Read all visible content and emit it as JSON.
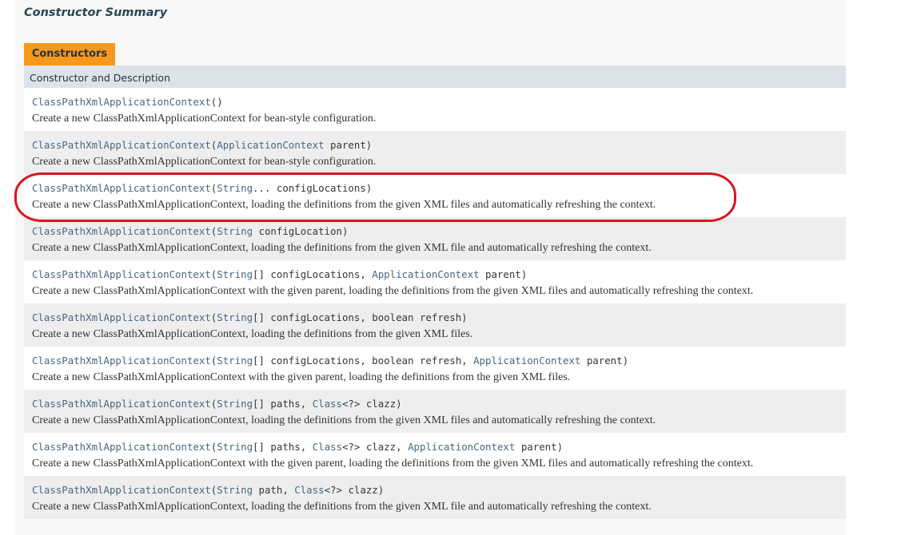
{
  "summary_title": "Constructor Summary",
  "tab_label": "Constructors",
  "table_header": "Constructor and Description",
  "accent_colors": {
    "tab": "#f8981d",
    "header": "#dee3e9",
    "link": "#4a6782",
    "annotation": "#d8151f"
  },
  "constructors": [
    {
      "name": "ClassPathXmlApplicationContext",
      "params": [],
      "description": "Create a new ClassPathXmlApplicationContext for bean-style configuration."
    },
    {
      "name": "ClassPathXmlApplicationContext",
      "params": [
        {
          "type": "ApplicationContext",
          "name": "parent"
        }
      ],
      "description": "Create a new ClassPathXmlApplicationContext for bean-style configuration."
    },
    {
      "name": "ClassPathXmlApplicationContext",
      "params": [
        {
          "type": "String",
          "suffix": "...",
          "name": "configLocations"
        }
      ],
      "description": "Create a new ClassPathXmlApplicationContext, loading the definitions from the given XML files and automatically refreshing the context.",
      "highlighted": true
    },
    {
      "name": "ClassPathXmlApplicationContext",
      "params": [
        {
          "type": "String",
          "name": "configLocation"
        }
      ],
      "description": "Create a new ClassPathXmlApplicationContext, loading the definitions from the given XML file and automatically refreshing the context."
    },
    {
      "name": "ClassPathXmlApplicationContext",
      "params": [
        {
          "type": "String",
          "suffix": "[]",
          "name": "configLocations"
        },
        {
          "type": "ApplicationContext",
          "name": "parent"
        }
      ],
      "description": "Create a new ClassPathXmlApplicationContext with the given parent, loading the definitions from the given XML files and automatically refreshing the context."
    },
    {
      "name": "ClassPathXmlApplicationContext",
      "params": [
        {
          "type": "String",
          "suffix": "[]",
          "name": "configLocations"
        },
        {
          "type": "boolean",
          "plain": true,
          "name": "refresh"
        }
      ],
      "description": "Create a new ClassPathXmlApplicationContext, loading the definitions from the given XML files."
    },
    {
      "name": "ClassPathXmlApplicationContext",
      "params": [
        {
          "type": "String",
          "suffix": "[]",
          "name": "configLocations"
        },
        {
          "type": "boolean",
          "plain": true,
          "name": "refresh"
        },
        {
          "type": "ApplicationContext",
          "name": "parent"
        }
      ],
      "description": "Create a new ClassPathXmlApplicationContext with the given parent, loading the definitions from the given XML files."
    },
    {
      "name": "ClassPathXmlApplicationContext",
      "params": [
        {
          "type": "String",
          "suffix": "[]",
          "name": "paths"
        },
        {
          "type": "Class",
          "suffix": "<?>",
          "name": "clazz"
        }
      ],
      "description": "Create a new ClassPathXmlApplicationContext, loading the definitions from the given XML files and automatically refreshing the context."
    },
    {
      "name": "ClassPathXmlApplicationContext",
      "params": [
        {
          "type": "String",
          "suffix": "[]",
          "name": "paths"
        },
        {
          "type": "Class",
          "suffix": "<?>",
          "name": "clazz"
        },
        {
          "type": "ApplicationContext",
          "name": "parent"
        }
      ],
      "description": "Create a new ClassPathXmlApplicationContext with the given parent, loading the definitions from the given XML files and automatically refreshing the context."
    },
    {
      "name": "ClassPathXmlApplicationContext",
      "params": [
        {
          "type": "String",
          "name": "path"
        },
        {
          "type": "Class",
          "suffix": "<?>",
          "name": "clazz"
        }
      ],
      "description": "Create a new ClassPathXmlApplicationContext, loading the definitions from the given XML file and automatically refreshing the context."
    }
  ]
}
